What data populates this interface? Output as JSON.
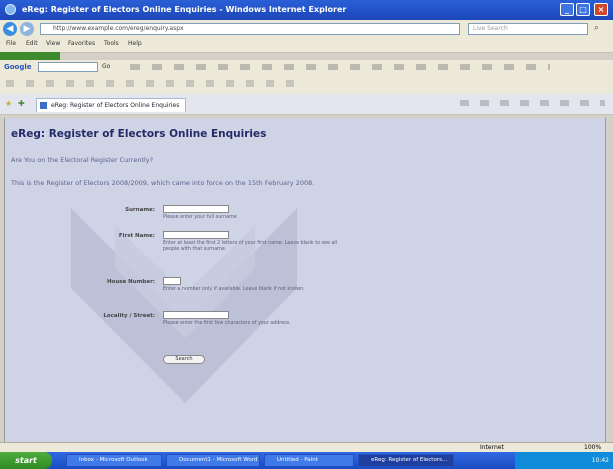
{
  "window": {
    "title": "eReg: Register of Electors Online Enquiries - Windows Internet Explorer"
  },
  "address_bar": {
    "url": "http://www.example.com/ereg/enquiry.aspx",
    "search_placeholder": "Live Search"
  },
  "menu": {
    "items": [
      "File",
      "Edit",
      "View",
      "Favorites",
      "Tools",
      "Help"
    ]
  },
  "google_bar": {
    "label": "Google",
    "search_label": "Go"
  },
  "tab": {
    "label": "eReg: Register of Electors Online Enquiries"
  },
  "page": {
    "heading": "eReg: Register of Electors Online Enquiries",
    "question": "Are You on the Electoral Register Currently?",
    "info": "This is the Register of Electors 2008/2009, which came into force on the 15th February 2008.",
    "form": {
      "surname_label": "Surname:",
      "surname_help": "Please enter your full surname",
      "first_name_label": "First Name:",
      "first_name_help": "Enter at least the first 2 letters of your first name. Leave blank to see all people with that surname.",
      "house_number_label": "House Number:",
      "house_number_help": "Enter a number only if available. Leave blank if not known.",
      "locality_label": "Locality / Street:",
      "locality_help": "Please enter the first few characters of your address.",
      "search_button": "Search"
    }
  },
  "status_bar": {
    "zone": "Internet",
    "zoom": "100%"
  },
  "taskbar": {
    "start_label": "start",
    "tasks": [
      "Inbox - Microsoft Outlook",
      "Document1 - Microsoft Word",
      "Untitled - Paint",
      "eReg: Register of Electors..."
    ],
    "clock": "10:42"
  }
}
